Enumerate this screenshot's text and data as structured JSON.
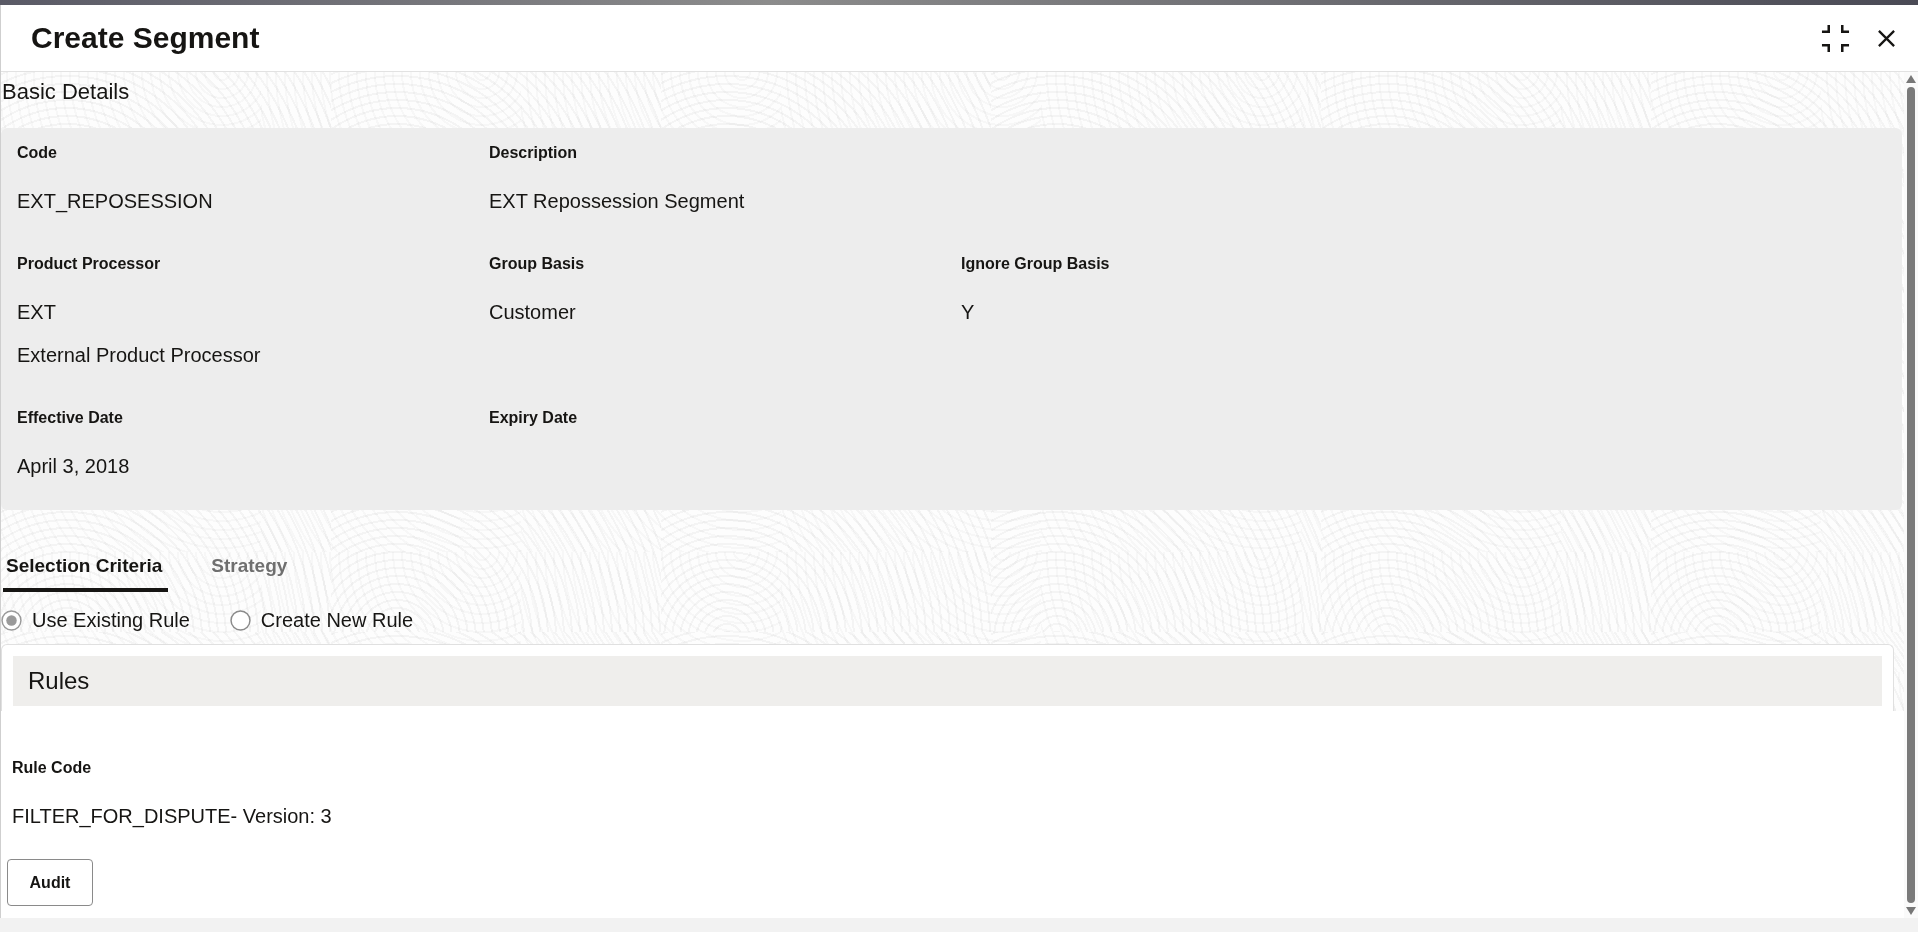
{
  "dialog": {
    "title": "Create Segment"
  },
  "basic_details": {
    "heading": "Basic Details",
    "rows": [
      [
        {
          "label": "Code",
          "values": [
            "EXT_REPOSESSION"
          ]
        },
        {
          "label": "Description",
          "values": [
            "EXT Repossession Segment"
          ]
        }
      ],
      [
        {
          "label": "Product Processor",
          "values": [
            "EXT",
            "External Product Processor"
          ]
        },
        {
          "label": "Group Basis",
          "values": [
            "Customer"
          ]
        },
        {
          "label": "Ignore Group Basis",
          "values": [
            "Y"
          ]
        }
      ],
      [
        {
          "label": "Effective Date",
          "values": [
            "April 3, 2018"
          ]
        },
        {
          "label": "Expiry Date"
        }
      ]
    ]
  },
  "tabs": [
    {
      "label": "Selection Criteria",
      "selected": true
    },
    {
      "label": "Strategy",
      "selected": false
    }
  ],
  "rule_options": [
    {
      "label": "Use Existing Rule",
      "selected": true
    },
    {
      "label": "Create New Rule",
      "selected": false
    }
  ],
  "rules": {
    "heading": "Rules",
    "fields": [
      {
        "label": "Rule Code",
        "values": [
          "FILTER_FOR_DISPUTE- Version: 3"
        ]
      }
    ]
  },
  "buttons": [
    {
      "label": "Audit"
    }
  ]
}
